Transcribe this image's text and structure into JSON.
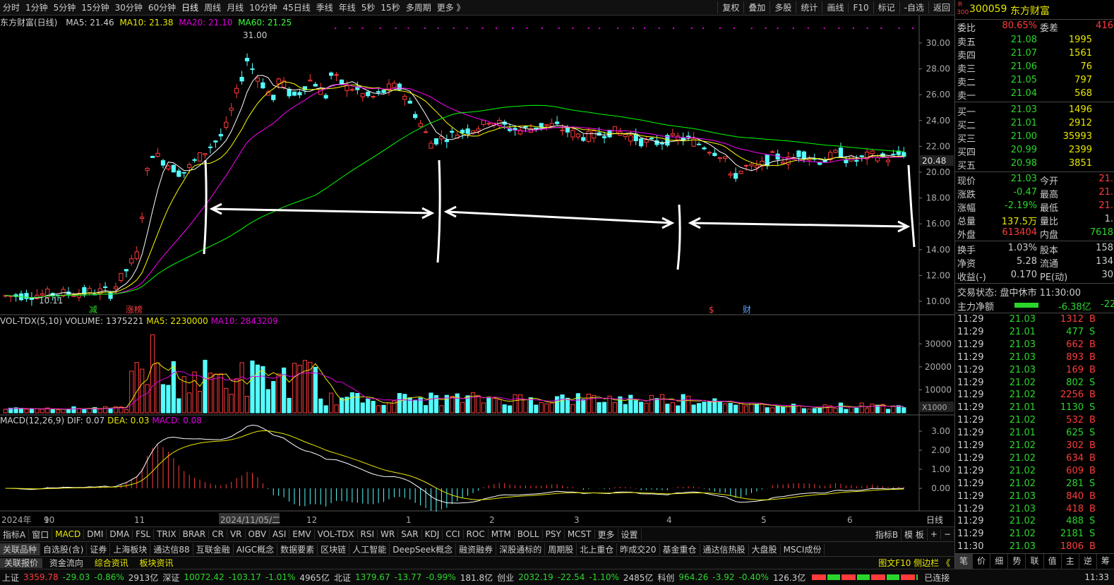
{
  "toolbar": {
    "periods": [
      "分时",
      "1分钟",
      "5分钟",
      "15分钟",
      "30分钟",
      "60分钟",
      "日线",
      "周线",
      "月线",
      "10分钟",
      "45日线",
      "季线",
      "年线",
      "5秒",
      "15秒",
      "多周期",
      "更多 》"
    ],
    "active": "日线",
    "right": [
      "复权",
      "叠加",
      "多股",
      "统计",
      "画线",
      "F10",
      "标记",
      "-自选",
      "返回"
    ]
  },
  "price_legend": {
    "name": "东方财富(日线)",
    "ma5": "MA5: 21.46",
    "ma10": "MA10: 21.38",
    "ma20": "MA20: 21.10",
    "ma60": "MA60: 21.25"
  },
  "price_axis": [
    "30.00",
    "28.00",
    "26.00",
    "24.00",
    "22.00",
    "20.00",
    "18.00",
    "16.00",
    "14.00",
    "12.00",
    "10.00"
  ],
  "price_marks": {
    "high": "31.00",
    "low": "10.11",
    "last": "20.48",
    "tag1": "减",
    "tag2": "涨榜",
    "tag3": "$",
    "tag4": "财"
  },
  "vol_legend": {
    "name": "VOL-TDX(5,10)",
    "volume": "VOLUME: 1375221",
    "ma5": "MA5: 2230000",
    "ma10": "MA10: 2843209"
  },
  "vol_axis": [
    "30000",
    "20000",
    "10000"
  ],
  "vol_unit": "X1000",
  "macd_legend": {
    "name": "MACD(12,26,9)",
    "dif": "DIF: 0.07",
    "dea": "DEA: 0.03",
    "macd": "MACD: 0.08"
  },
  "macd_axis": [
    "3.00",
    "2.00",
    "1.00",
    "0.00"
  ],
  "time_axis": {
    "year": "2024年",
    "labels": [
      "9",
      "10",
      "11",
      "2024/11/05/二",
      "12",
      "1",
      "2",
      "3",
      "4",
      "5",
      "6"
    ],
    "mode": "日线"
  },
  "indicator_tabs": [
    "指标A",
    "窗口",
    "MACD",
    "DMI",
    "DMA",
    "FSL",
    "TRIX",
    "BRAR",
    "CR",
    "VR",
    "OBV",
    "ASI",
    "EMV",
    "VOL-TDX",
    "RSI",
    "WR",
    "SAR",
    "KDJ",
    "CCI",
    "ROC",
    "MTM",
    "BOLL",
    "PSY",
    "MCST",
    "更多",
    "设置"
  ],
  "indicator_right": [
    "指标B",
    "模 板",
    "+",
    "−"
  ],
  "sector_tabs": [
    "关联品种",
    "自选股(含)",
    "证券",
    "上海板块",
    "通达信88",
    "互联金融",
    "AIGC概念",
    "数据要素",
    "区块链",
    "人工智能",
    "DeepSeek概念",
    "融资融券",
    "深股通标的",
    "周期股",
    "北上重仓",
    "昨成交20",
    "基金重仓",
    "通达信热股",
    "大盘股",
    "MSCI成份"
  ],
  "quote": {
    "code": "300059",
    "name": "东方财富",
    "rank": "R",
    "index": "300",
    "committee": [
      {
        "l": "委比",
        "v": "80.65%",
        "l2": "委差",
        "v2": "416"
      }
    ],
    "asks": [
      {
        "l": "卖五",
        "p": "21.08",
        "q": "1995"
      },
      {
        "l": "卖四",
        "p": "21.07",
        "q": "1561"
      },
      {
        "l": "卖三",
        "p": "21.06",
        "q": "76"
      },
      {
        "l": "卖二",
        "p": "21.05",
        "q": "797"
      },
      {
        "l": "卖一",
        "p": "21.04",
        "q": "568"
      }
    ],
    "bids": [
      {
        "l": "买一",
        "p": "21.03",
        "q": "1496"
      },
      {
        "l": "买二",
        "p": "21.01",
        "q": "2912"
      },
      {
        "l": "买三",
        "p": "21.00",
        "q": "35993"
      },
      {
        "l": "买四",
        "p": "20.99",
        "q": "2399"
      },
      {
        "l": "买五",
        "p": "20.98",
        "q": "3851"
      }
    ],
    "stats": [
      {
        "l": "现价",
        "v": "21.03",
        "l2": "今开",
        "v2": "21."
      },
      {
        "l": "涨跌",
        "v": "-0.47",
        "l2": "最高",
        "v2": "21."
      },
      {
        "l": "涨幅",
        "v": "-2.19%",
        "l2": "最低",
        "v2": "21."
      },
      {
        "l": "总量",
        "v": "137.5万",
        "l2": "量比",
        "v2": "1."
      },
      {
        "l": "外盘",
        "v": "613404",
        "l2": "内盘",
        "v2": "7618"
      }
    ],
    "stats2": [
      {
        "l": "换手",
        "v": "1.03%",
        "l2": "股本",
        "v2": "158"
      },
      {
        "l": "净资",
        "v": "5.28",
        "l2": "流通",
        "v2": "134"
      },
      {
        "l": "收益(-)",
        "v": "0.170",
        "l2": "PE(动)",
        "v2": "30"
      }
    ],
    "trade_status": "交易状态: 盘中休市 11:30:00",
    "main_flow_label": "主力净额",
    "main_flow": "-6.38亿",
    "main_flow2": "-22"
  },
  "ticks": [
    [
      "11:29",
      "21.03",
      "1312",
      "B"
    ],
    [
      "11:29",
      "21.01",
      "477",
      "S"
    ],
    [
      "11:29",
      "21.03",
      "662",
      "B"
    ],
    [
      "11:29",
      "21.03",
      "893",
      "B"
    ],
    [
      "11:29",
      "21.03",
      "169",
      "B"
    ],
    [
      "11:29",
      "21.02",
      "802",
      "S"
    ],
    [
      "11:29",
      "21.02",
      "2256",
      "B"
    ],
    [
      "11:29",
      "21.01",
      "1130",
      "S"
    ],
    [
      "11:29",
      "21.02",
      "532",
      "B"
    ],
    [
      "11:29",
      "21.01",
      "625",
      "S"
    ],
    [
      "11:29",
      "21.02",
      "302",
      "B"
    ],
    [
      "11:29",
      "21.02",
      "634",
      "B"
    ],
    [
      "11:29",
      "21.02",
      "609",
      "B"
    ],
    [
      "11:29",
      "21.02",
      "281",
      "S"
    ],
    [
      "11:29",
      "21.03",
      "840",
      "B"
    ],
    [
      "11:29",
      "21.03",
      "418",
      "B"
    ],
    [
      "11:29",
      "21.02",
      "488",
      "S"
    ],
    [
      "11:29",
      "21.02",
      "2181",
      "S"
    ],
    [
      "11:30",
      "21.03",
      "1806",
      "B"
    ]
  ],
  "side_tabs": [
    "笔",
    "价",
    "细",
    "势",
    "联",
    "值",
    "主",
    "逆",
    "筹"
  ],
  "status": {
    "tab1": "关联报价",
    "tab2": "资金流向",
    "tab3": "综合资讯",
    "tab4": "板块资讯",
    "right1": "图文F10 侧边栏 《",
    "sh": "上证",
    "sh_v": "3359.78",
    "sh_c": "-29.03",
    "sh_p": "-0.86%",
    "sh_a": "2913亿",
    "sz": "深证",
    "sz_v": "10072.42",
    "sz_c": "-103.17",
    "sz_p": "-1.01%",
    "sz_a": "4965亿",
    "bz": "北证",
    "bz_v": "1379.67",
    "bz_c": "-13.77",
    "bz_p": "-0.99%",
    "bz_a": "181.8亿",
    "cy": "创业",
    "cy_v": "2032.19",
    "cy_c": "-22.54",
    "cy_p": "-1.10%",
    "cy_a": "2485亿",
    "kc": "科创",
    "kc_v": "964.26",
    "kc_c": "-3.92",
    "kc_p": "-0.40%",
    "kc_a": "126.3亿",
    "conn": "已连接",
    "time": "11:33"
  },
  "colors": {
    "up": "#ff3b3b",
    "down": "#54ffff",
    "ma5": "#ffffff",
    "ma10": "#ffff00",
    "ma20": "#ff00ff",
    "ma60": "#00ff00"
  }
}
